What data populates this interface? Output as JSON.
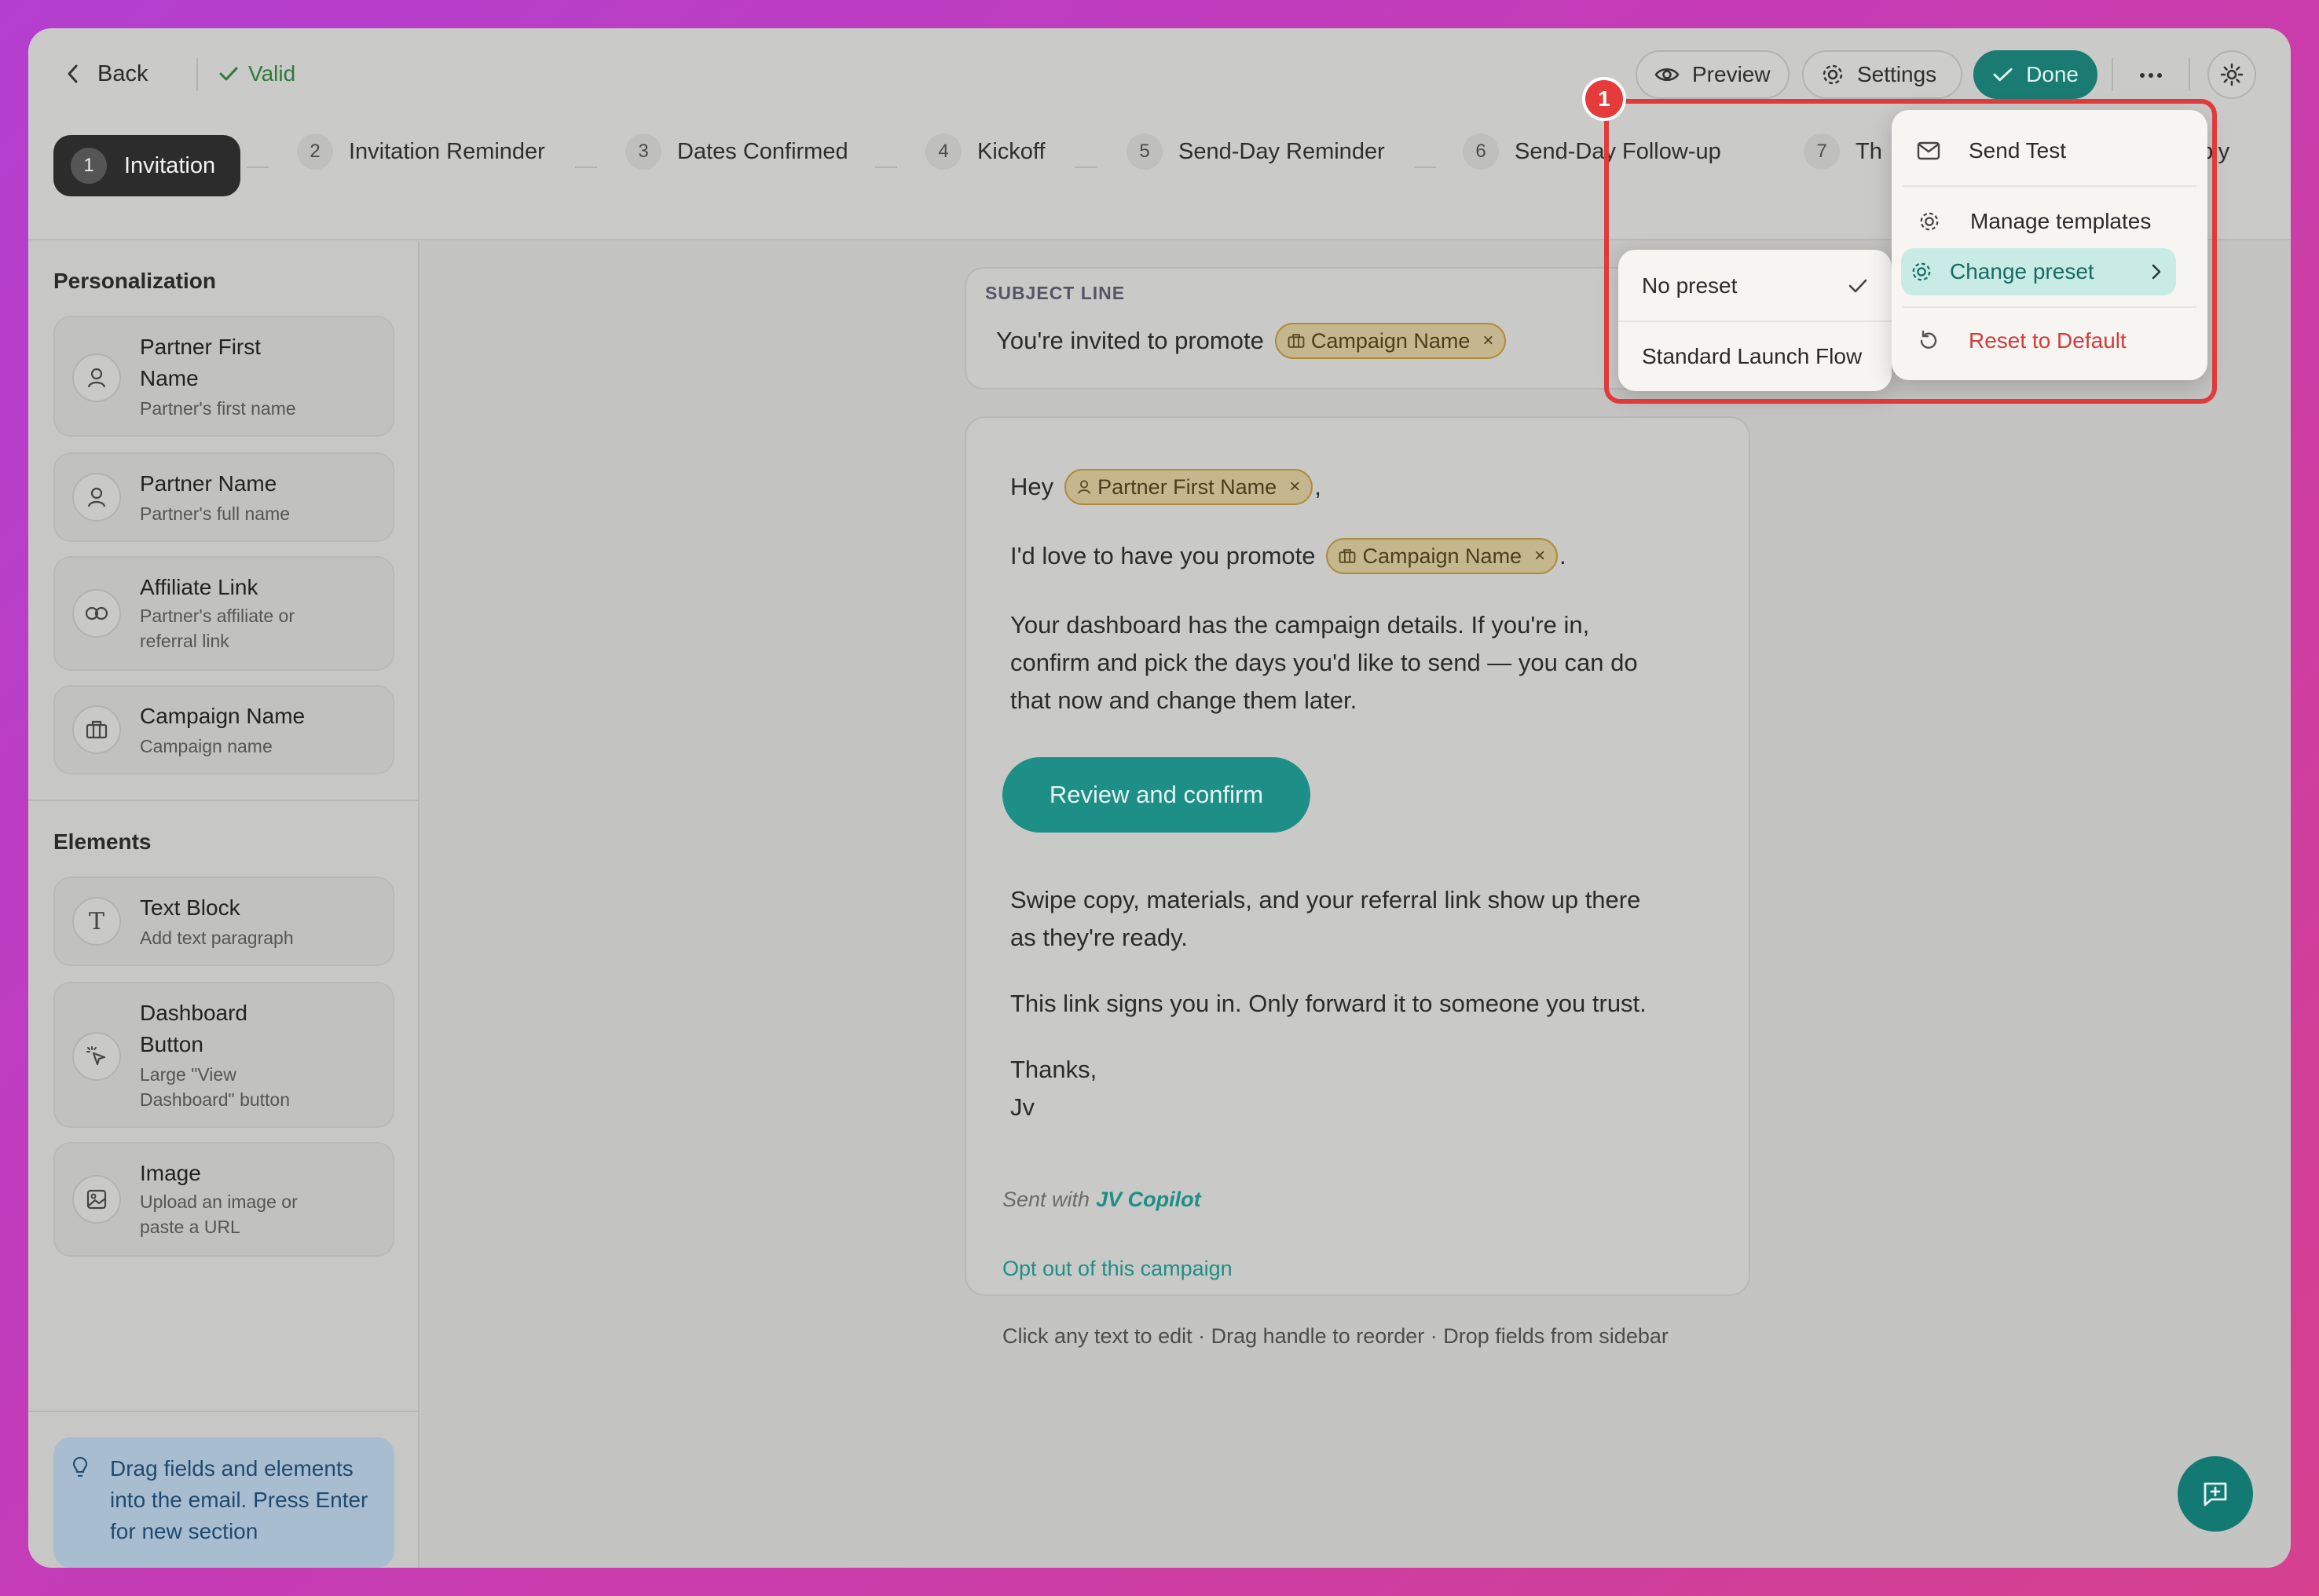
{
  "topbar": {
    "back_label": "Back",
    "valid_label": "Valid",
    "preview_label": "Preview",
    "settings_label": "Settings",
    "done_label": "Done",
    "more_icon": "ellipsis-icon",
    "theme_icon": "sun-icon"
  },
  "steps": [
    {
      "num": "1",
      "label": "Invitation",
      "active": true
    },
    {
      "num": "2",
      "label": "Invitation Reminder"
    },
    {
      "num": "3",
      "label": "Dates Confirmed"
    },
    {
      "num": "4",
      "label": "Kickoff"
    },
    {
      "num": "5",
      "label": "Send-Day Reminder"
    },
    {
      "num": "6",
      "label": "Send-Day Follow-up"
    },
    {
      "num": "7",
      "label": "Th"
    },
    {
      "label": "Reply"
    }
  ],
  "sidebar": {
    "personalization_title": "Personalization",
    "fields": [
      {
        "title_line1": "Partner First",
        "title_line2": "Name",
        "subtitle": "Partner's first name",
        "icon": "user-icon"
      },
      {
        "title": "Partner Name",
        "subtitle": "Partner's full name",
        "icon": "user-icon"
      },
      {
        "title": "Affiliate Link",
        "subtitle_line1": "Partner's affiliate or",
        "subtitle_line2": "referral link",
        "icon": "link-icon"
      },
      {
        "title": "Campaign Name",
        "subtitle": "Campaign name",
        "icon": "briefcase-icon"
      }
    ],
    "elements_title": "Elements",
    "elements": [
      {
        "title": "Text Block",
        "subtitle": "Add text paragraph",
        "icon": "text-icon"
      },
      {
        "title_line1": "Dashboard",
        "title_line2": "Button",
        "subtitle_line1": "Large \"View",
        "subtitle_line2": "Dashboard\" button",
        "icon": "cursor-click-icon"
      },
      {
        "title": "Image",
        "subtitle_line1": "Upload an image or",
        "subtitle_line2": "paste a URL",
        "icon": "image-icon"
      }
    ],
    "tip_line1": "Drag fields and elements",
    "tip_line2": "into the email. Press Enter",
    "tip_line3": "for new section"
  },
  "subject": {
    "label": "SUBJECT LINE",
    "prefix": "You're invited to promote",
    "chip": "Campaign Name"
  },
  "email": {
    "greeting": "Hey",
    "greeting_chip": "Partner First Name",
    "greeting_suffix": ",",
    "line2_prefix": "I'd love to have you promote",
    "line2_chip": "Campaign Name",
    "line2_suffix": ".",
    "para1_line1": "Your dashboard has the campaign details. If you're in,",
    "para1_line2": "confirm and pick the days you'd like to send — you can do",
    "para1_line3": "that now and change them later.",
    "button": "Review and confirm",
    "para2_line1": "Swipe copy, materials, and your referral link show up there",
    "para2_line2": "as they're ready.",
    "para3": "This link signs you in. Only forward it to someone you trust.",
    "thanks": "Thanks,",
    "signature": "Jv",
    "sent_with": "Sent with",
    "brand": "JV Copilot",
    "opt_out": "Opt out of this campaign"
  },
  "hint": "Click any text to edit · Drag handle to reorder · Drop fields from sidebar",
  "menu": {
    "send_test": "Send Test",
    "manage_templates": "Manage templates",
    "change_preset": "Change preset",
    "reset": "Reset to Default"
  },
  "submenu": {
    "no_preset": "No preset",
    "standard": "Standard Launch Flow"
  },
  "annotation_badge": "1",
  "colors": {
    "accent": "#1a8f86",
    "danger": "#d23b3b",
    "highlight_border": "#e03a3a"
  }
}
